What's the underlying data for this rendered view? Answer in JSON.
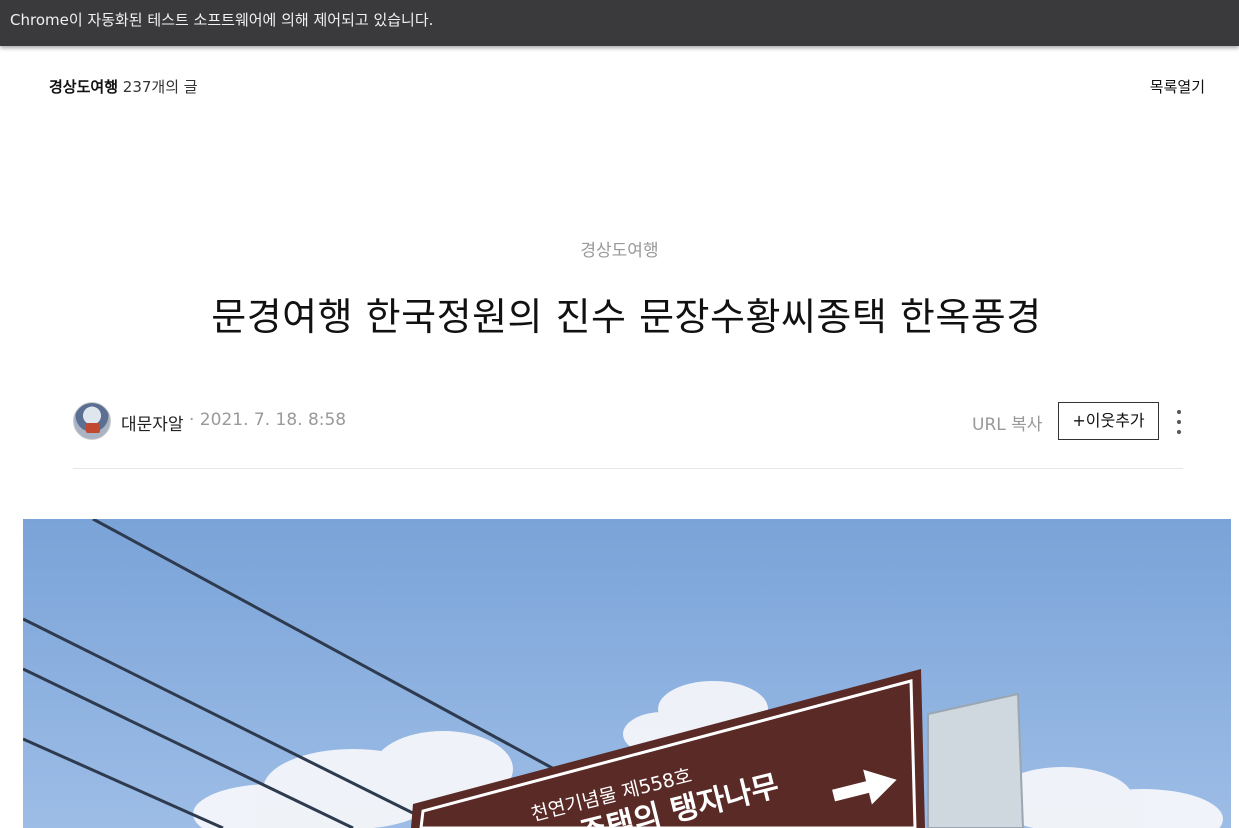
{
  "browser": {
    "automation_notice": "Chrome이 자동화된 테스트 소프트웨어에 의해 제어되고 있습니다."
  },
  "top_nav": {
    "category_name": "경상도여행",
    "post_count": "237개의 글",
    "toggle_list_label": "목록열기"
  },
  "post": {
    "category": "경상도여행",
    "title": "문경여행 한국정원의 진수 문장수황씨종택 한옥풍경",
    "author": "대문자알",
    "date": "· 2021. 7. 18. 8:58",
    "url_copy_label": "URL 복사",
    "add_neighbor_label": "+이웃추가",
    "more_icon": "more-vertical-icon"
  },
  "photo": {
    "sign_line1": "천연기념물 제558호",
    "sign_line2": "주택의 탱자나무",
    "sign_color": "#5a2a26",
    "sky_color": "#7fa8dc"
  }
}
